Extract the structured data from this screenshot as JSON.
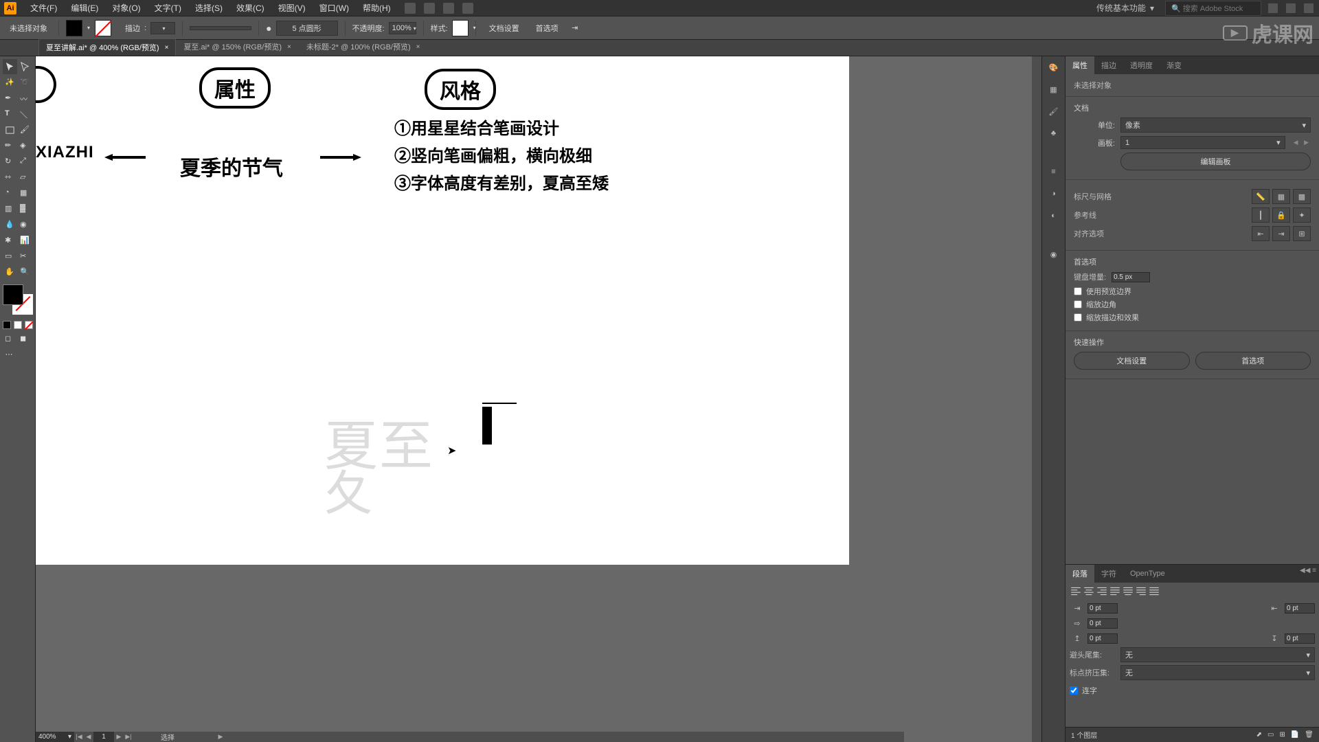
{
  "app": {
    "icon_label": "Ai"
  },
  "menubar": {
    "items": [
      "文件(F)",
      "编辑(E)",
      "对象(O)",
      "文字(T)",
      "选择(S)",
      "效果(C)",
      "视图(V)",
      "窗口(W)",
      "帮助(H)"
    ],
    "workspace": "传统基本功能",
    "search_ph": "搜索 Adobe Stock"
  },
  "options": {
    "no_selection": "未选择对象",
    "stroke_label": "描边",
    "stroke_weight": "",
    "stroke_profile": "5 点圆形",
    "opacity_label": "不透明度:",
    "opacity_value": "100%",
    "style_label": "样式:",
    "doc_setup": "文档设置",
    "prefs": "首选项"
  },
  "tabs": [
    {
      "label": "夏至讲解.ai* @ 400% (RGB/预览)",
      "active": true
    },
    {
      "label": "夏至.ai* @ 150% (RGB/预览)",
      "active": false
    },
    {
      "label": "未标题-2* @ 100% (RGB/预览)",
      "active": false
    }
  ],
  "statusbar": {
    "zoom": "400%",
    "artboard_idx": "1",
    "tool": "选择"
  },
  "canvas": {
    "pill_attr": "属性",
    "pill_style": "风格",
    "xiazhi": "XIAZHI",
    "season": "夏季的节气",
    "style1": "①用星星结合笔画设计",
    "style2": "②竖向笔画偏粗，横向极细",
    "style3": "③字体高度有差别，夏高至矮",
    "sketch_xia": "夏",
    "sketch_zhi": "至",
    "sketch_xia2": "夂"
  },
  "properties_panel": {
    "tabs": [
      "属性",
      "描边",
      "透明度",
      "渐变"
    ],
    "no_selection": "未选择对象",
    "doc_header": "文档",
    "units_label": "单位:",
    "units_value": "像素",
    "artboard_label": "画板:",
    "artboard_value": "1",
    "edit_artboards": "编辑画板",
    "ruler_header": "标尺与网格",
    "guides_header": "参考线",
    "align_header": "对齐选项",
    "prefs_header": "首选项",
    "key_incr_label": "键盘增量:",
    "key_incr_value": "0.5 px",
    "chk1": "使用预览边界",
    "chk2": "缩放边角",
    "chk3": "缩放描边和效果",
    "quick_header": "快速操作",
    "doc_setup": "文档设置",
    "prefs_btn": "首选项"
  },
  "paragraph_panel": {
    "tabs": [
      "段落",
      "字符",
      "OpenType"
    ],
    "f": {
      "il": "0 pt",
      "ir": "0 pt",
      "fl": "0 pt",
      "sb": "0 pt",
      "sa": "0 pt"
    },
    "avoid_label": "避头尾集:",
    "avoid_val": "无",
    "punct_label": "标点挤压集:",
    "punct_val": "无",
    "hyphen": "连字"
  },
  "layers_status": {
    "count": "1 个图层"
  },
  "watermark": "虎课网"
}
